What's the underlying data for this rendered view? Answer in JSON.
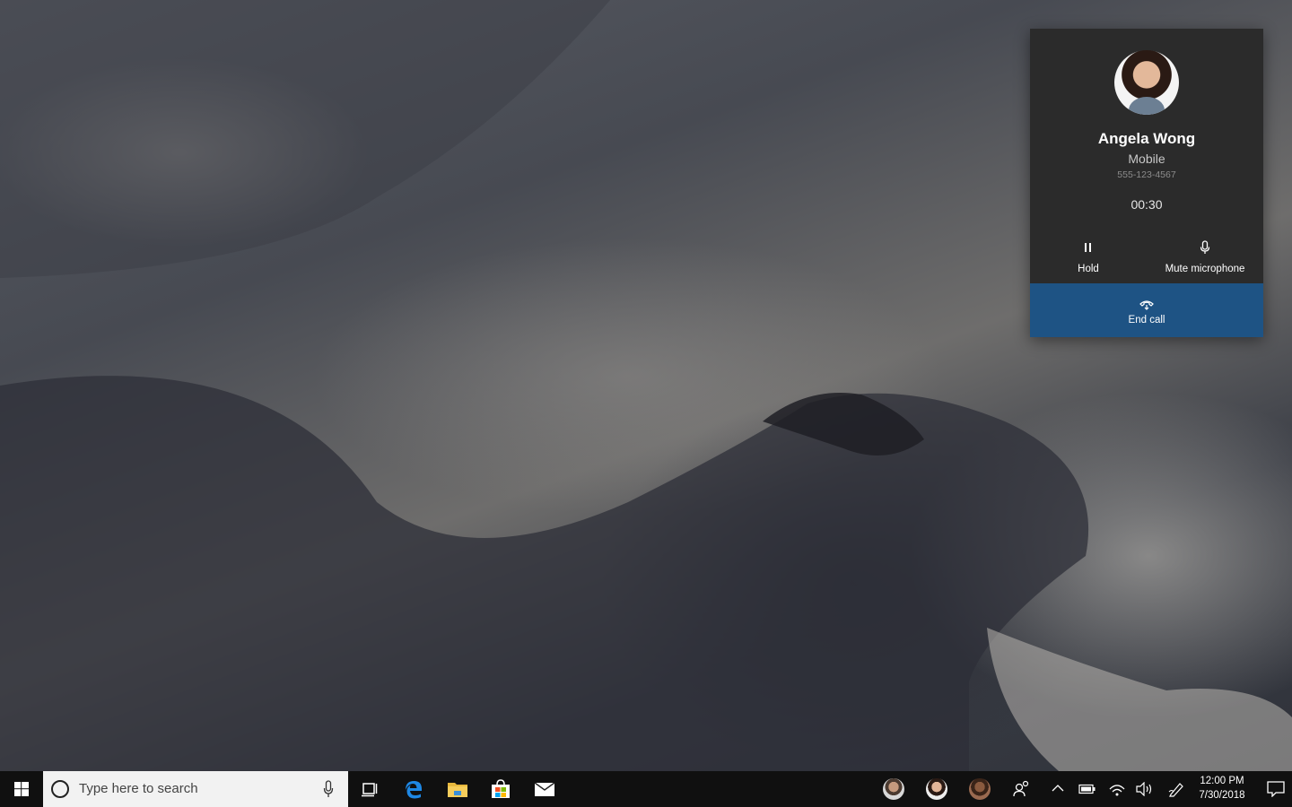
{
  "call": {
    "caller_name": "Angela Wong",
    "caller_type": "Mobile",
    "caller_number": "555-123-4567",
    "timer": "00:30",
    "hold_label": "Hold",
    "mute_label": "Mute microphone",
    "end_call_label": "End call",
    "end_call_color": "#1e5384"
  },
  "taskbar": {
    "search_placeholder": "Type here to search",
    "pinned_apps": [
      "task-view-icon",
      "edge-icon",
      "file-explorer-icon",
      "store-icon",
      "mail-icon"
    ],
    "people_contacts": 3,
    "clock_time": "12:00 PM",
    "clock_date": "7/30/2018"
  }
}
